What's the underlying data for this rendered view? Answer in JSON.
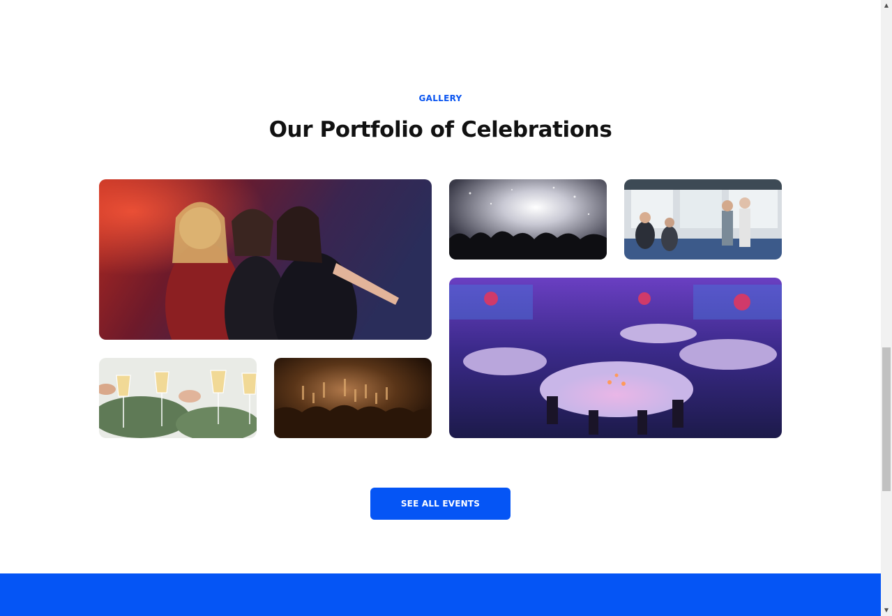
{
  "gallery": {
    "eyebrow": "GALLERY",
    "title": "Our Portfolio of Celebrations",
    "images": [
      {
        "name": "friends-dancing-party-photo"
      },
      {
        "name": "concert-crowd-confetti-photo"
      },
      {
        "name": "business-presentation-applause-photo"
      },
      {
        "name": "banquet-hall-round-tables-photo"
      },
      {
        "name": "champagne-toast-glasses-photo"
      },
      {
        "name": "concert-audience-hands-photo"
      }
    ]
  },
  "cta": {
    "label": "SEE ALL EVENTS"
  },
  "colors": {
    "accent": "#0555F5",
    "heading": "#111111",
    "eyebrow": "#0A55F0"
  },
  "scrollbar": {
    "up_icon": "arrow-up-icon",
    "down_icon": "arrow-down-icon"
  }
}
